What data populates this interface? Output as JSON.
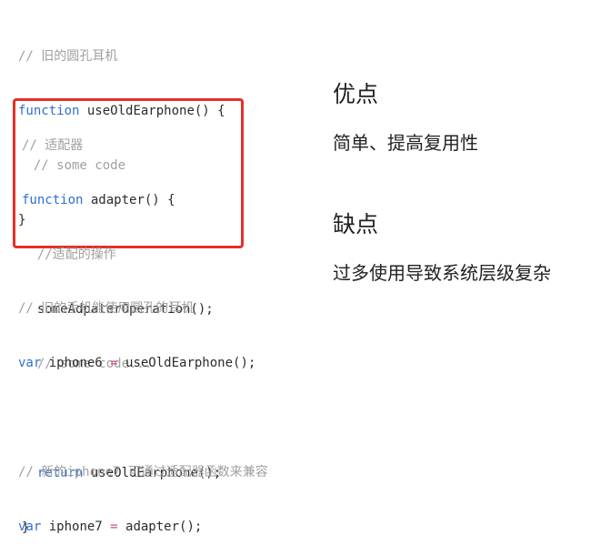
{
  "code_top": {
    "comment": "// 旧的圆孔耳机",
    "keyword": "function",
    "signature": " useOldEarphone() {",
    "body_comment": "  // some code",
    "close": "}"
  },
  "code_adapter": {
    "comment": "// 适配器",
    "keyword": "function",
    "signature": " adapter() {",
    "body_comment": "  //适配的操作",
    "operation": "  someAdpaterOperation();",
    "more_comment": "  // some code...",
    "return_indent": "  ",
    "return_keyword": "return",
    "return_call": " useOldEarphone();",
    "close": "}"
  },
  "code_bottom": {
    "comment1": "// 旧的手机能使用圆孔的耳机",
    "var1_keyword": "var",
    "var1_name": " iphone6 ",
    "var1_op": "=",
    "var1_value": " useOldEarphone();",
    "comment2": "// 新的iphone7 可通过适配器函数来兼容",
    "var2_keyword": "var",
    "var2_name": " iphone7 ",
    "var2_op": "=",
    "var2_value": " adapter();"
  },
  "notes": {
    "pros_title": "优点",
    "pros_text": "简单、提高复用性",
    "cons_title": "缺点",
    "cons_text": "过多使用导致系统层级复杂"
  },
  "colors": {
    "comment": "#a0a0a0",
    "keyword": "#2f6fd0",
    "operator": "#d24b92",
    "text": "#2b2b2b",
    "highlight_border": "#e2302a"
  }
}
